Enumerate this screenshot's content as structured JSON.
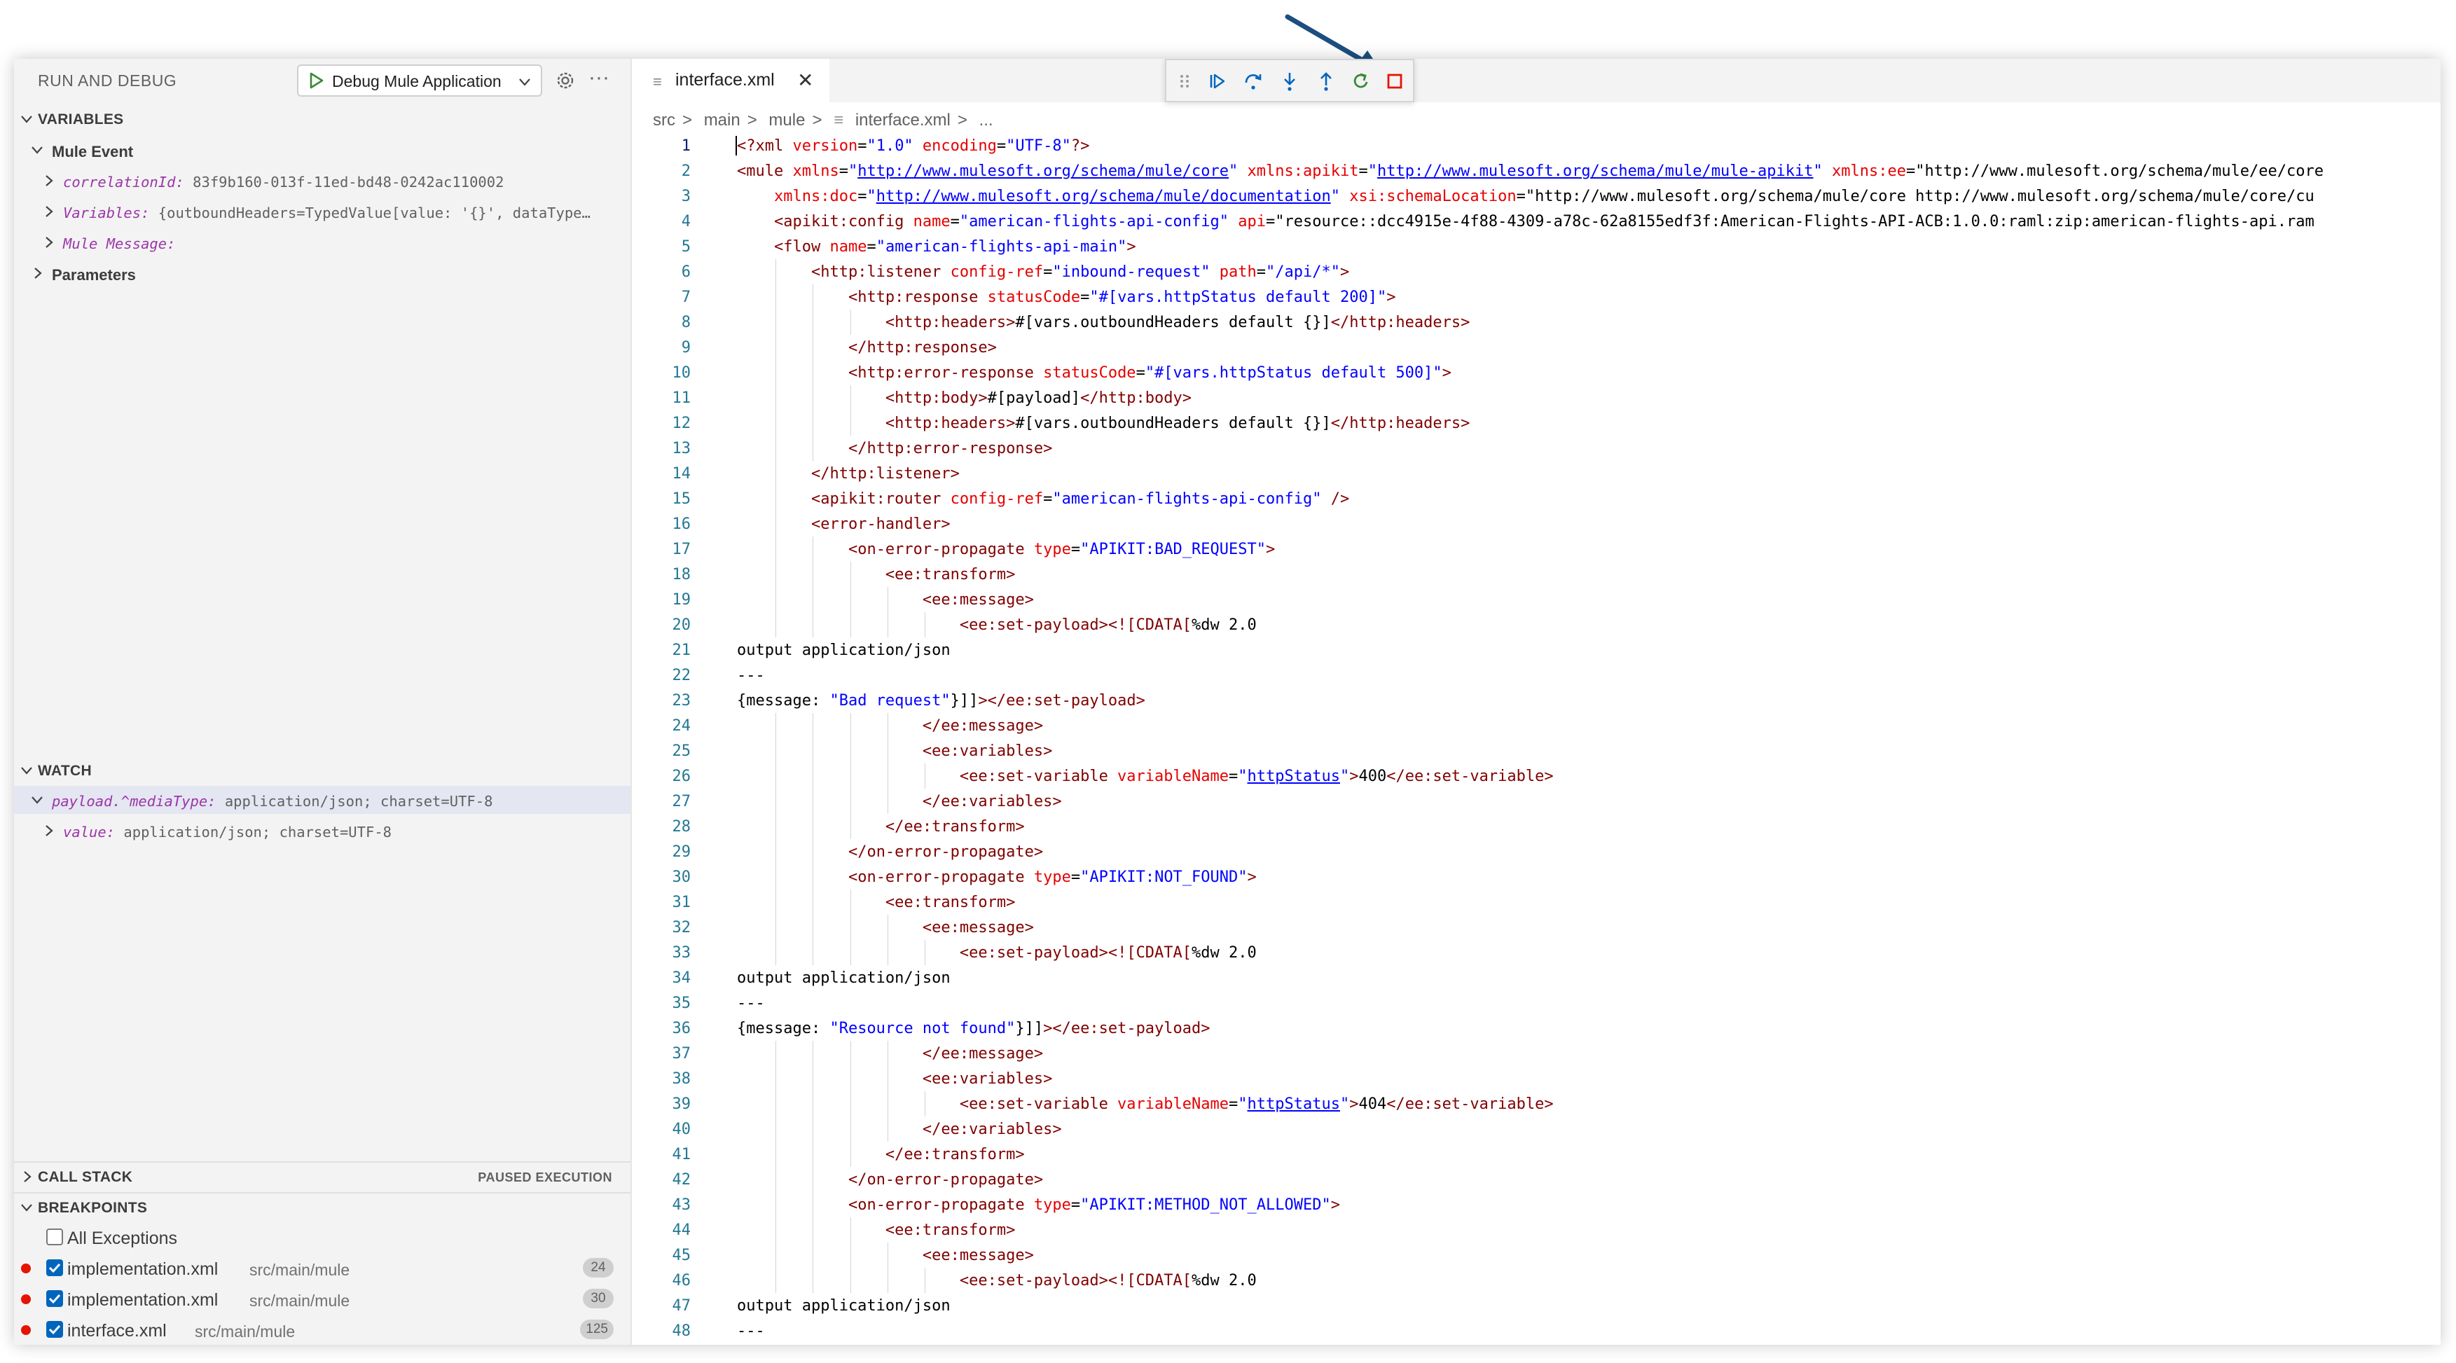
{
  "sidebar": {
    "title": "RUN AND DEBUG",
    "config": "Debug Mule Application",
    "sections": {
      "variables": "VARIABLES",
      "watch": "WATCH",
      "callstack": "CALL STACK",
      "callstack_status": "PAUSED EXECUTION",
      "breakpoints": "BREAKPOINTS"
    },
    "variables": {
      "group": "Mule Event",
      "correlation_key": "correlationId:",
      "correlation_val": "83f9b160-013f-11ed-bd48-0242ac110002",
      "variables_key": "Variables:",
      "variables_val": "{outboundHeaders=TypedValue[value: '{}', dataType…",
      "message_key": "Mule Message:",
      "params": "Parameters"
    },
    "watch": {
      "expr_key": "payload.^mediaType:",
      "expr_val": "application/json; charset=UTF-8",
      "child_key": "value:",
      "child_val": "application/json; charset=UTF-8"
    },
    "breakpoints": [
      {
        "label": "All Exceptions",
        "checked": false
      },
      {
        "label": "implementation.xml",
        "path": "src/main/mule",
        "line": "24",
        "checked": true
      },
      {
        "label": "implementation.xml",
        "path": "src/main/mule",
        "line": "30",
        "checked": true
      },
      {
        "label": "interface.xml",
        "path": "src/main/mule",
        "line": "125",
        "checked": true
      }
    ]
  },
  "editor": {
    "tab": "interface.xml",
    "breadcrumb": [
      "src",
      ">",
      "main",
      ">",
      "mule",
      ">",
      "interface.xml",
      ">",
      "..."
    ],
    "debug_toolbar": [
      "drag-handle-icon",
      "continue-icon",
      "step-over-icon",
      "step-into-icon",
      "step-out-icon",
      "restart-icon",
      "stop-icon"
    ],
    "colors": {
      "accent": "#0065bd",
      "stop": "#e51400",
      "restart": "#388a34",
      "annotation_arrow": "#1c4e80"
    },
    "lines": [
      "<?xml version=\"1.0\" encoding=\"UTF-8\"?>",
      "<mule xmlns=\"http://www.mulesoft.org/schema/mule/core\" xmlns:apikit=\"http://www.mulesoft.org/schema/mule/mule-apikit\" xmlns:ee=\"http://www.mulesoft.org/schema/mule/ee/core",
      "    xmlns:doc=\"http://www.mulesoft.org/schema/mule/documentation\" xsi:schemaLocation=\"http://www.mulesoft.org/schema/mule/core http://www.mulesoft.org/schema/mule/core/cu",
      "    <apikit:config name=\"american-flights-api-config\" api=\"resource::dcc4915e-4f88-4309-a78c-62a8155edf3f:American-Flights-API-ACB:1.0.0:raml:zip:american-flights-api.ram",
      "    <flow name=\"american-flights-api-main\">",
      "        <http:listener config-ref=\"inbound-request\" path=\"/api/*\">",
      "            <http:response statusCode=\"#[vars.httpStatus default 200]\">",
      "                <http:headers>#[vars.outboundHeaders default {}]</http:headers>",
      "            </http:response>",
      "            <http:error-response statusCode=\"#[vars.httpStatus default 500]\">",
      "                <http:body>#[payload]</http:body>",
      "                <http:headers>#[vars.outboundHeaders default {}]</http:headers>",
      "            </http:error-response>",
      "        </http:listener>",
      "        <apikit:router config-ref=\"american-flights-api-config\" />",
      "        <error-handler>",
      "            <on-error-propagate type=\"APIKIT:BAD_REQUEST\">",
      "                <ee:transform>",
      "                    <ee:message>",
      "                        <ee:set-payload><![CDATA[%dw 2.0",
      "output application/json",
      "---",
      "{message: \"Bad request\"}]]></ee:set-payload>",
      "                    </ee:message>",
      "                    <ee:variables>",
      "                        <ee:set-variable variableName=\"httpStatus\">400</ee:set-variable>",
      "                    </ee:variables>",
      "                </ee:transform>",
      "            </on-error-propagate>",
      "            <on-error-propagate type=\"APIKIT:NOT_FOUND\">",
      "                <ee:transform>",
      "                    <ee:message>",
      "                        <ee:set-payload><![CDATA[%dw 2.0",
      "output application/json",
      "---",
      "{message: \"Resource not found\"}]]></ee:set-payload>",
      "                    </ee:message>",
      "                    <ee:variables>",
      "                        <ee:set-variable variableName=\"httpStatus\">404</ee:set-variable>",
      "                    </ee:variables>",
      "                </ee:transform>",
      "            </on-error-propagate>",
      "            <on-error-propagate type=\"APIKIT:METHOD_NOT_ALLOWED\">",
      "                <ee:transform>",
      "                    <ee:message>",
      "                        <ee:set-payload><![CDATA[%dw 2.0",
      "output application/json",
      "---"
    ]
  }
}
